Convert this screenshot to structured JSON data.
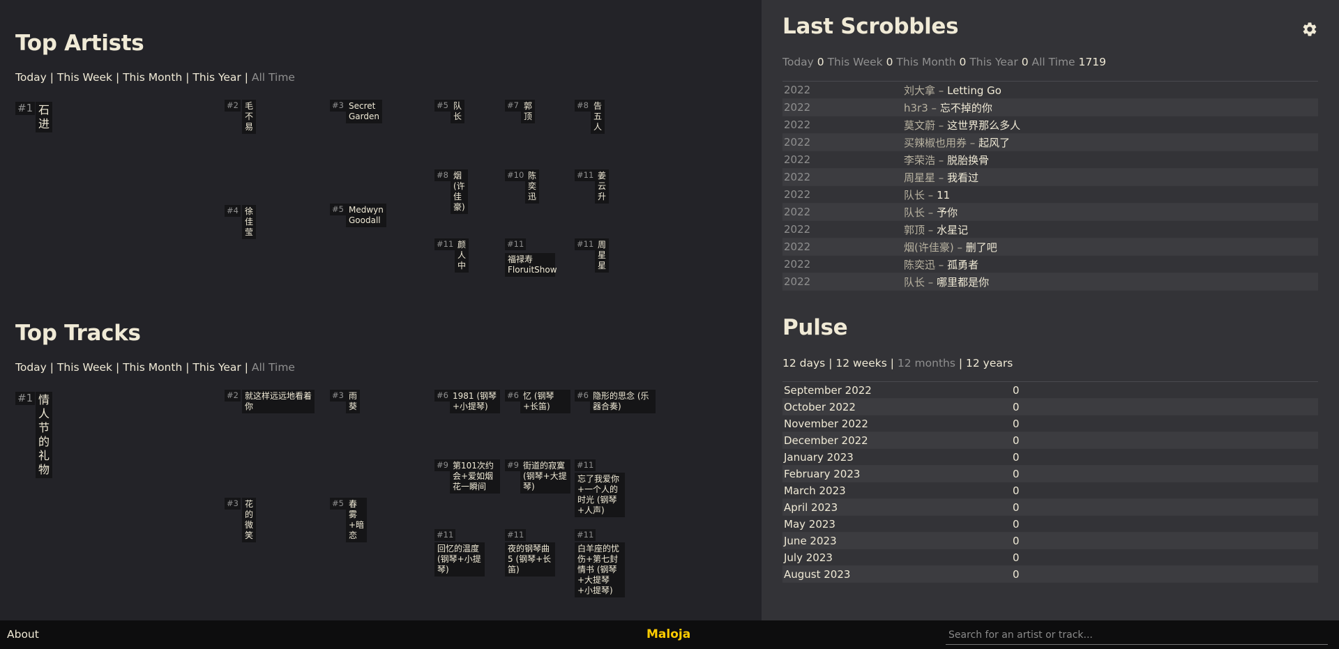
{
  "top_artists": {
    "title": "Top Artists",
    "filters": [
      "Today",
      "This Week",
      "This Month",
      "This Year",
      "All Time"
    ],
    "tiles": [
      {
        "rank": "#1",
        "name": "石进"
      },
      {
        "rank": "#2",
        "name": "毛不易"
      },
      {
        "rank": "#3",
        "name": "Secret Garden"
      },
      {
        "rank": "#4",
        "name": "徐佳莹"
      },
      {
        "rank": "#5",
        "name": "Medwyn Goodall"
      },
      {
        "rank": "#5",
        "name": "队长"
      },
      {
        "rank": "#7",
        "name": "郭顶"
      },
      {
        "rank": "#8",
        "name": "告五人"
      },
      {
        "rank": "#8",
        "name": "烟(许佳豪)"
      },
      {
        "rank": "#10",
        "name": "陈奕迅"
      },
      {
        "rank": "#11",
        "name": "姜云升"
      },
      {
        "rank": "#11",
        "name": "颜人中"
      },
      {
        "rank": "#11",
        "name": "福禄寿 FloruitShow"
      },
      {
        "rank": "#11",
        "name": "周星星"
      }
    ]
  },
  "top_tracks": {
    "title": "Top Tracks",
    "filters": [
      "Today",
      "This Week",
      "This Month",
      "This Year",
      "All Time"
    ],
    "tiles": [
      {
        "rank": "#1",
        "name": "情人节的礼物"
      },
      {
        "rank": "#2",
        "name": "就这样远远地看着你"
      },
      {
        "rank": "#3",
        "name": "雨葵"
      },
      {
        "rank": "#3",
        "name": "花的微笑"
      },
      {
        "rank": "#5",
        "name": "春雾+暗恋"
      },
      {
        "rank": "#6",
        "name": "1981 (钢琴+小提琴)"
      },
      {
        "rank": "#6",
        "name": "忆 (钢琴+长笛)"
      },
      {
        "rank": "#6",
        "name": "隐形的思念 (乐器合奏)"
      },
      {
        "rank": "#9",
        "name": "第101次约会+爱如烟花一瞬间"
      },
      {
        "rank": "#9",
        "name": "街道的寂寞 (钢琴+大提琴)"
      },
      {
        "rank": "#11",
        "name": "忘了我爱你+一个人的时光 (钢琴+人声)"
      },
      {
        "rank": "#11",
        "name": "回忆的温度 (钢琴+小提琴)"
      },
      {
        "rank": "#11",
        "name": "夜的钢琴曲5 (钢琴+长笛)"
      },
      {
        "rank": "#11",
        "name": "白羊座的忧伤+第七封情书 (钢琴+大提琴+小提琴)"
      }
    ]
  },
  "last_scrobbles": {
    "title": "Last Scrobbles",
    "counts": [
      {
        "label": "Today",
        "value": "0"
      },
      {
        "label": "This Week",
        "value": "0"
      },
      {
        "label": "This Month",
        "value": "0"
      },
      {
        "label": "This Year",
        "value": "0"
      },
      {
        "label": "All Time",
        "value": "1719"
      }
    ],
    "rows": [
      {
        "time": "2022",
        "artist": "刘大拿",
        "track": "Letting Go"
      },
      {
        "time": "2022",
        "artist": "h3r3",
        "track": "忘不掉的你"
      },
      {
        "time": "2022",
        "artist": "莫文蔚",
        "track": "这世界那么多人"
      },
      {
        "time": "2022",
        "artist": "买辣椒也用券",
        "track": "起风了"
      },
      {
        "time": "2022",
        "artist": "李荣浩",
        "track": "脱胎换骨"
      },
      {
        "time": "2022",
        "artist": "周星星",
        "track": "我看过"
      },
      {
        "time": "2022",
        "artist": "队长",
        "track": "11"
      },
      {
        "time": "2022",
        "artist": "队长",
        "track": "予你"
      },
      {
        "time": "2022",
        "artist": "郭顶",
        "track": "水星记"
      },
      {
        "time": "2022",
        "artist": "烟(许佳豪)",
        "track": "删了吧"
      },
      {
        "time": "2022",
        "artist": "陈奕迅",
        "track": "孤勇者"
      },
      {
        "time": "2022",
        "artist": "队长",
        "track": "哪里都是你"
      }
    ]
  },
  "pulse": {
    "title": "Pulse",
    "filters": [
      "12 days",
      "12 weeks",
      "12 months",
      "12 years"
    ],
    "rows": [
      {
        "month": "September 2022",
        "count": "0"
      },
      {
        "month": "October 2022",
        "count": "0"
      },
      {
        "month": "November 2022",
        "count": "0"
      },
      {
        "month": "December 2022",
        "count": "0"
      },
      {
        "month": "January 2023",
        "count": "0"
      },
      {
        "month": "February 2023",
        "count": "0"
      },
      {
        "month": "March 2023",
        "count": "0"
      },
      {
        "month": "April 2023",
        "count": "0"
      },
      {
        "month": "May 2023",
        "count": "0"
      },
      {
        "month": "June 2023",
        "count": "0"
      },
      {
        "month": "July 2023",
        "count": "0"
      },
      {
        "month": "August 2023",
        "count": "0"
      }
    ]
  },
  "footer": {
    "about": "About",
    "brand": "Maloja",
    "search_placeholder": "Search for an artist or track..."
  },
  "icons": {
    "settings": "gear-icon"
  },
  "colors": {
    "accent": "#ffcc00",
    "text": "#f0ead6",
    "muted": "#8f8f8f"
  }
}
